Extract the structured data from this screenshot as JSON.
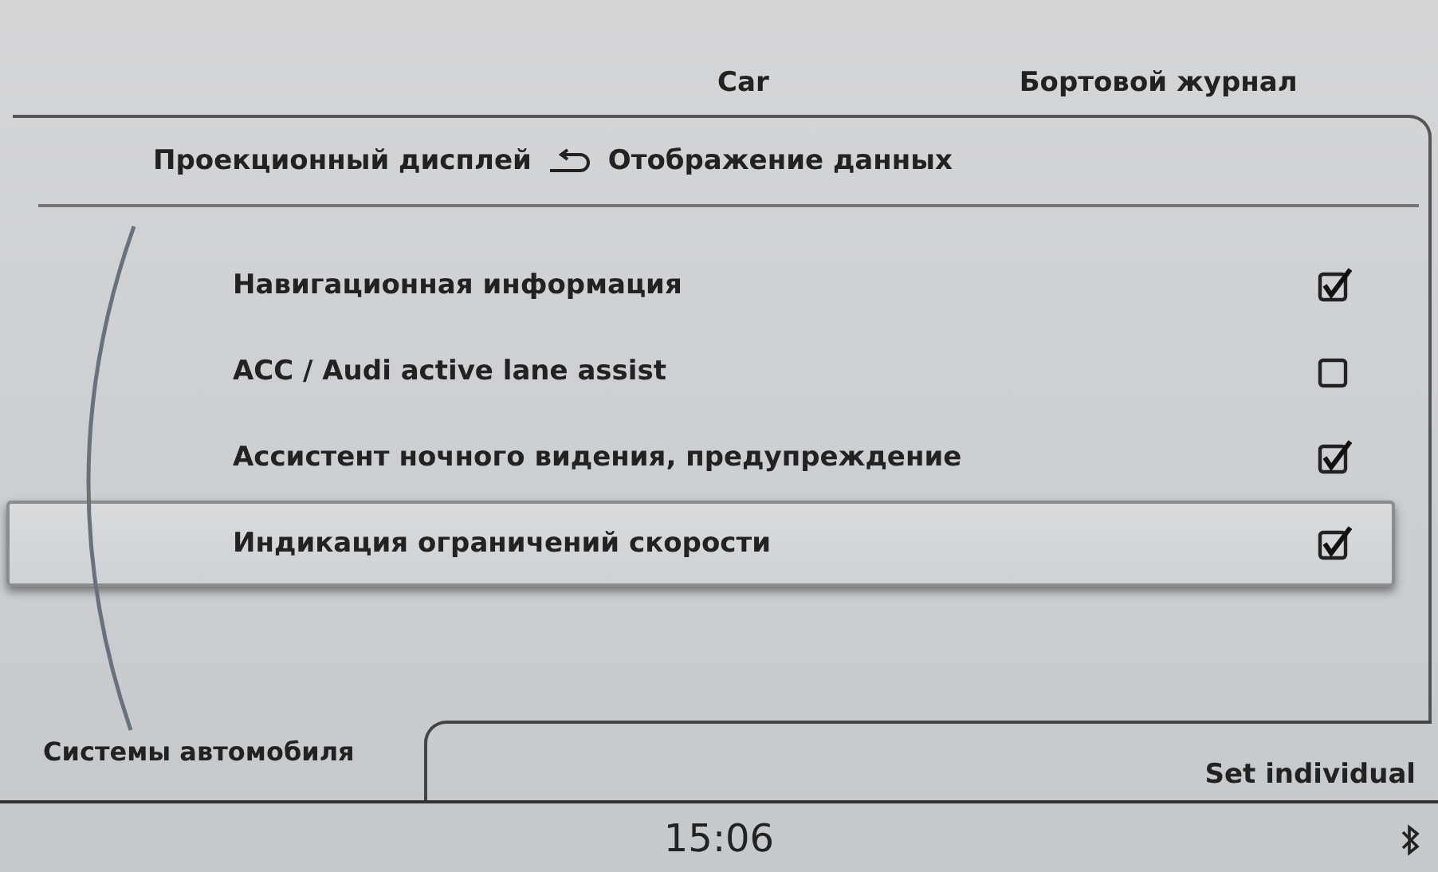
{
  "tabs": [
    {
      "label": "Car"
    },
    {
      "label": "Бортовой журнал"
    }
  ],
  "breadcrumb": {
    "parent": "Проекционный дисплей",
    "current": "Отображение данных"
  },
  "options": [
    {
      "label": "Навигационная информация",
      "checked": true,
      "selected": false
    },
    {
      "label": "ACC / Audi active lane assist",
      "checked": false,
      "selected": false
    },
    {
      "label": "Ассистент ночного видения, предупреждение",
      "checked": true,
      "selected": false
    },
    {
      "label": "Индикация ограничений скорости",
      "checked": true,
      "selected": true
    }
  ],
  "menu_label": "Системы автомобиля",
  "preset_tab": "Set individual",
  "status_bar": {
    "time": "15:06"
  }
}
